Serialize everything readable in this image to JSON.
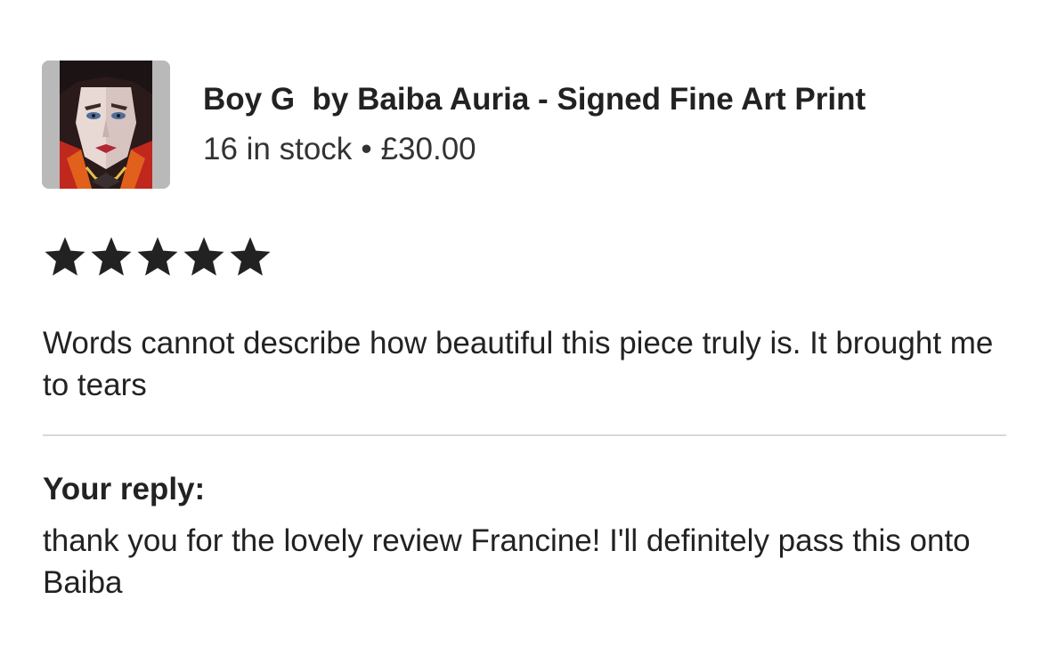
{
  "listing": {
    "title": "Boy G  by Baiba Auria - Signed Fine Art Print",
    "stock": "16 in stock",
    "separator": "•",
    "price": "£30.00"
  },
  "review": {
    "rating": 5,
    "rating_max": 5,
    "text": "Words cannot describe how beautiful this piece truly is. It brought me to tears"
  },
  "reply": {
    "label": "Your reply:",
    "text": "thank you for the lovely review Francine! I'll definitely pass this onto Baiba"
  },
  "colors": {
    "text": "#222222",
    "star": "#222222",
    "divider": "#d8d8d8",
    "thumb_background": "#b9b9b9"
  }
}
